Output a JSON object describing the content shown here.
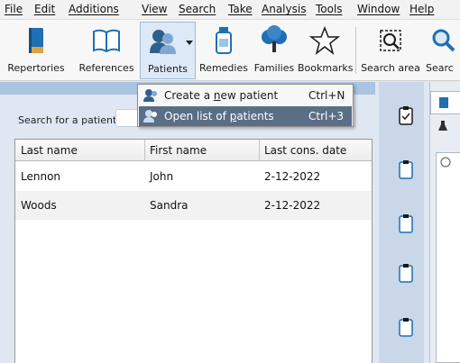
{
  "menu": [
    {
      "label": "File"
    },
    {
      "label": "Edit"
    },
    {
      "label": "Additions"
    },
    {
      "label": "View"
    },
    {
      "label": "Search"
    },
    {
      "label": "Take"
    },
    {
      "label": "Analysis"
    },
    {
      "label": "Tools"
    },
    {
      "label": "Window"
    },
    {
      "label": "Help"
    }
  ],
  "toolbar": {
    "repertories": "Repertories",
    "references": "References",
    "patients": "Patients",
    "remedies": "Remedies",
    "families": "Families",
    "bookmarks": "Bookmarks",
    "search_area": "Search area",
    "search_truncated": "Searc"
  },
  "search": {
    "label": "Search for a patient:",
    "value": ""
  },
  "table": {
    "columns": [
      "Last name",
      "First name",
      "Last cons. date"
    ],
    "rows": [
      [
        "Lennon",
        "John",
        "2-12-2022"
      ],
      [
        "Woods",
        "Sandra",
        "2-12-2022"
      ]
    ]
  },
  "dropdown": {
    "create": {
      "pre": "Create a ",
      "u": "n",
      "post": "ew patient",
      "shortcut": "Ctrl+N"
    },
    "open": {
      "pre": "Open list of ",
      "u": "p",
      "post": "atients",
      "shortcut": "Ctrl+3"
    }
  },
  "colors": {
    "accent": "#1f6fb5",
    "highlight": "#5a6e86",
    "panel": "#dfe7f2"
  }
}
